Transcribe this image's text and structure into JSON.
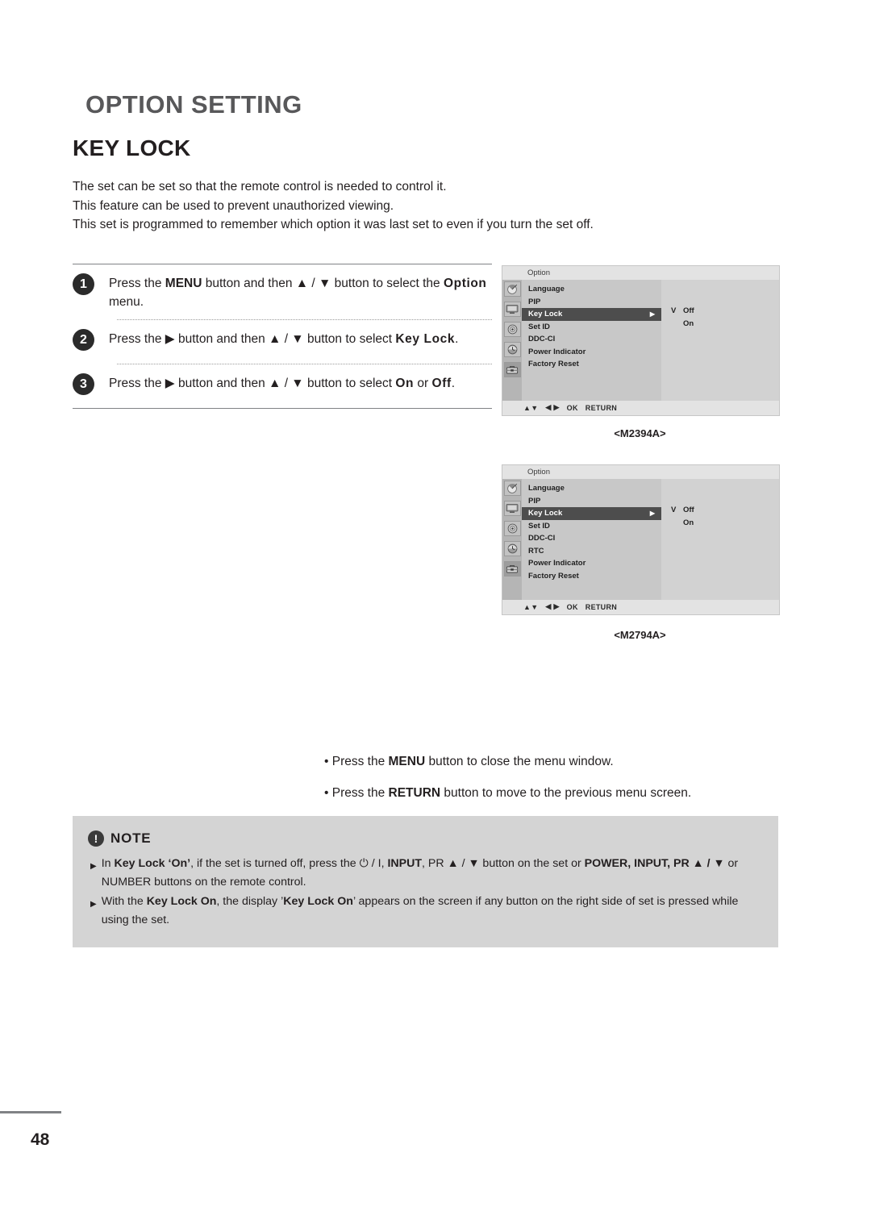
{
  "document": {
    "page_title": "OPTION SETTING",
    "section_title": "KEY LOCK",
    "page_number": "48"
  },
  "intro": {
    "line1": "The set can be set so that the remote control is needed to control it.",
    "line2": "This feature can be used to prevent unauthorized viewing.",
    "line3": "This set is programmed to remember which option it was last set to even if you turn the set off."
  },
  "steps": [
    {
      "number": "1",
      "prefix": "Press the ",
      "kw1": "MENU",
      "mid": " button and then ▲ / ▼ button to select the ",
      "kw2": "Option",
      "suffix": " menu."
    },
    {
      "number": "2",
      "prefix": "Press the ▶ button and then ▲ / ▼ button to select ",
      "kw1": "Key Lock",
      "suffix": "."
    },
    {
      "number": "3",
      "prefix": "Press the ▶ button and then ▲ / ▼ button to select ",
      "kw1": "On",
      "mid": " or ",
      "kw2": "Off",
      "suffix": "."
    }
  ],
  "osd_panels": [
    {
      "title": "Option",
      "caption": "<M2394A>",
      "menu_items": [
        "Language",
        "PIP",
        "Key Lock",
        "Set ID",
        "DDC-CI",
        "Power Indicator",
        "Factory Reset"
      ],
      "selected_item": "Key Lock",
      "selected_caret": "▶",
      "values": [
        {
          "mark": "V",
          "label": "Off"
        },
        {
          "mark": "",
          "label": "On"
        }
      ],
      "footer": [
        "▲▼",
        "◀ ▶",
        "OK",
        "RETURN"
      ],
      "icons": [
        "satellite-dish-icon",
        "monitor-icon",
        "disc-icon",
        "clock-icon",
        "toolbox-icon"
      ]
    },
    {
      "title": "Option",
      "caption": "<M2794A>",
      "menu_items": [
        "Language",
        "PIP",
        "Key Lock",
        "Set ID",
        "DDC-CI",
        "RTC",
        "Power Indicator",
        "Factory Reset"
      ],
      "selected_item": "Key Lock",
      "selected_caret": "▶",
      "values": [
        {
          "mark": "V",
          "label": "Off"
        },
        {
          "mark": "",
          "label": "On"
        }
      ],
      "footer": [
        "▲▼",
        "◀ ▶",
        "OK",
        "RETURN"
      ],
      "icons": [
        "satellite-dish-icon",
        "monitor-icon",
        "disc-icon",
        "clock-icon",
        "toolbox-icon"
      ]
    }
  ],
  "bullets": [
    {
      "prefix": "• Press the ",
      "kw": "MENU",
      "suffix": " button to close the menu window."
    },
    {
      "prefix": "• Press the ",
      "kw": "RETURN",
      "suffix": " button to move to the previous menu screen."
    }
  ],
  "note": {
    "label": "NOTE",
    "icon": "!",
    "items": [
      {
        "line1_a": "In ",
        "line1_kw1": "Key Lock ‘On’",
        "line1_b": ", if the set is turned off, press the ⏻ / I, ",
        "line1_kw2": "INPUT",
        "line1_c": ", PR ▲ / ▼ button on the set or ",
        "line1_kw3": "POWER,",
        "line2_kw": "INPUT,  PR ▲ / ▼",
        "line2_b": " or NUMBER buttons on the remote control."
      },
      {
        "line1_a": "With the ",
        "line1_kw1": "Key Lock On",
        "line1_b": ", the display ’",
        "line1_kw2": "Key Lock On",
        "line1_c": "’ appears on the screen if any button on the right side of set is",
        "line2": "pressed while using the set."
      }
    ]
  },
  "colors": {
    "heading_gray": "#58585a",
    "rule_gray": "#808285",
    "osd_bg": "#d2d2d2",
    "osd_list_bg": "#c8c8c8",
    "osd_selected": "#4d4d4d",
    "note_bg": "#d4d4d4"
  }
}
